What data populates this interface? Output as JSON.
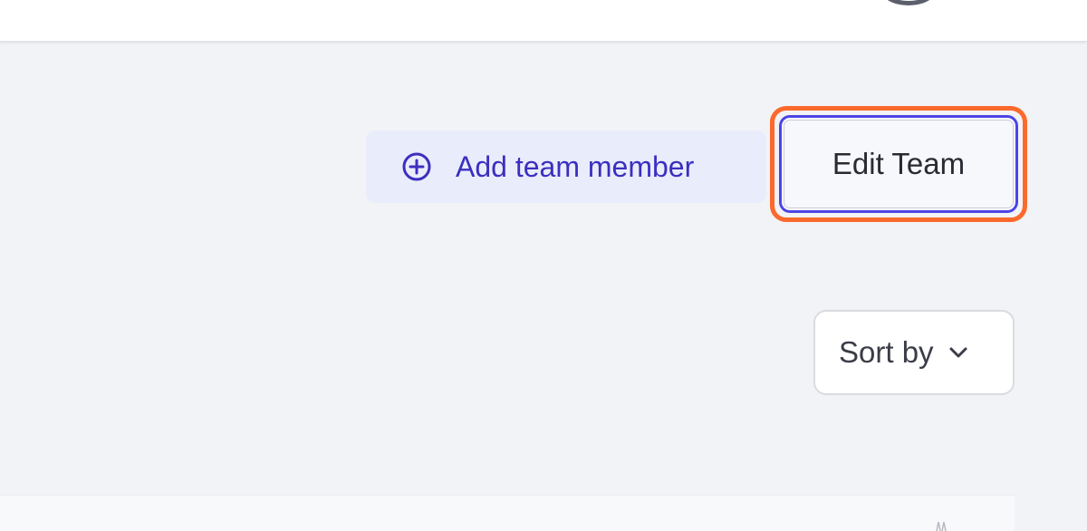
{
  "header": {
    "avatar_icon": "user-avatar"
  },
  "team_actions": {
    "add_member_label": "Add team member",
    "add_member_icon": "plus-circle-icon",
    "edit_team_label": "Edit Team"
  },
  "list_controls": {
    "sort_label": "Sort by",
    "sort_icon": "chevron-down-icon"
  },
  "colors": {
    "background": "#f2f3f6",
    "accent": "#3b2fc0",
    "focus_ring_outer": "#fb6a2c",
    "focus_ring_inner": "#4c45e6"
  }
}
